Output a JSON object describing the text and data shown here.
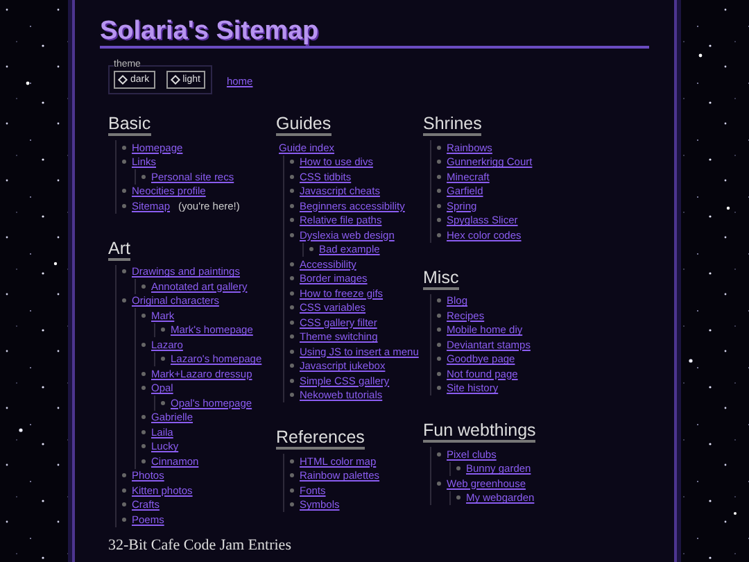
{
  "title": "Solaria's Sitemap",
  "theme": {
    "legend": "theme",
    "buttons": [
      {
        "label": "dark"
      },
      {
        "label": "light"
      }
    ]
  },
  "home_link": "home",
  "columns": [
    {
      "sections": [
        {
          "title": "Basic",
          "items": [
            {
              "text": "Homepage"
            },
            {
              "text": "Links",
              "children": [
                {
                  "text": "Personal site recs"
                }
              ]
            },
            {
              "text": "Neocities profile"
            },
            {
              "text": "Sitemap",
              "note": "(you're here!)"
            }
          ]
        },
        {
          "title": "Art",
          "items": [
            {
              "text": "Drawings and paintings",
              "children": [
                {
                  "text": "Annotated art gallery"
                }
              ]
            },
            {
              "text": "Original characters",
              "children": [
                {
                  "text": "Mark",
                  "children": [
                    {
                      "text": "Mark's homepage"
                    }
                  ]
                },
                {
                  "text": "Lazaro",
                  "children": [
                    {
                      "text": "Lazaro's homepage"
                    }
                  ]
                },
                {
                  "text": "Mark+Lazaro dressup"
                },
                {
                  "text": "Opal",
                  "children": [
                    {
                      "text": "Opal's homepage"
                    }
                  ]
                },
                {
                  "text": "Gabrielle"
                },
                {
                  "text": "Laila"
                },
                {
                  "text": "Lucky"
                },
                {
                  "text": "Cinnamon"
                }
              ]
            },
            {
              "text": "Photos"
            },
            {
              "text": "Kitten photos"
            },
            {
              "text": "Crafts"
            },
            {
              "text": "Poems"
            }
          ]
        }
      ]
    },
    {
      "sections": [
        {
          "title": "Guides",
          "index_link": "Guide index",
          "items": [
            {
              "text": "How to use divs"
            },
            {
              "text": "CSS tidbits"
            },
            {
              "text": "Javascript cheats"
            },
            {
              "text": "Beginners accessibility"
            },
            {
              "text": "Relative file paths"
            },
            {
              "text": "Dyslexia web design",
              "children": [
                {
                  "text": "Bad example"
                }
              ]
            },
            {
              "text": "Accessibility"
            },
            {
              "text": "Border images"
            },
            {
              "text": "How to freeze gifs"
            },
            {
              "text": "CSS variables"
            },
            {
              "text": "CSS gallery filter"
            },
            {
              "text": "Theme switching"
            },
            {
              "text": "Using JS to insert a menu"
            },
            {
              "text": "Javascript jukebox"
            },
            {
              "text": "Simple CSS gallery"
            },
            {
              "text": "Nekoweb tutorials"
            }
          ]
        },
        {
          "title": "References",
          "items": [
            {
              "text": "HTML color map"
            },
            {
              "text": "Rainbow palettes"
            },
            {
              "text": "Fonts"
            },
            {
              "text": "Symbols"
            }
          ]
        }
      ]
    },
    {
      "sections": [
        {
          "title": "Shrines",
          "items": [
            {
              "text": "Rainbows"
            },
            {
              "text": "Gunnerkrigg Court"
            },
            {
              "text": "Minecraft"
            },
            {
              "text": "Garfield"
            },
            {
              "text": "Spring"
            },
            {
              "text": "Spyglass Slicer"
            },
            {
              "text": "Hex color codes"
            }
          ]
        },
        {
          "title": "Misc",
          "items": [
            {
              "text": "Blog"
            },
            {
              "text": "Recipes"
            },
            {
              "text": "Mobile home diy"
            },
            {
              "text": "Deviantart stamps"
            },
            {
              "text": "Goodbye page"
            },
            {
              "text": "Not found page"
            },
            {
              "text": "Site history"
            }
          ]
        },
        {
          "title": "Fun webthings",
          "items": [
            {
              "text": "Pixel clubs",
              "children": [
                {
                  "text": "Bunny garden"
                }
              ]
            },
            {
              "text": "Web greenhouse",
              "children": [
                {
                  "text": "My webgarden"
                }
              ]
            }
          ]
        }
      ]
    }
  ],
  "footer_heading": "32-Bit Cafe Code Jam Entries"
}
